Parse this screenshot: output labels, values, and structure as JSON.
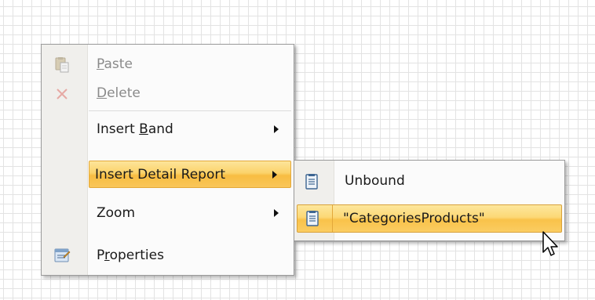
{
  "context_menu": {
    "items": [
      {
        "pre": "",
        "u": "P",
        "post": "aste",
        "icon": "paste-icon",
        "disabled": true
      },
      {
        "pre": "",
        "u": "D",
        "post": "elete",
        "icon": "delete-icon",
        "disabled": true
      },
      {
        "pre": "Insert ",
        "u": "B",
        "post": "and",
        "icon": "",
        "submenu": true
      },
      {
        "pre": "Insert Detail Report",
        "u": "",
        "post": "",
        "icon": "",
        "submenu": true,
        "highlighted": true
      },
      {
        "pre": "Zoom",
        "u": "",
        "post": "",
        "icon": "",
        "submenu": true
      },
      {
        "pre": "P",
        "u": "r",
        "post": "operties",
        "icon": "properties-icon"
      }
    ]
  },
  "submenu": {
    "items": [
      {
        "label": "Unbound",
        "icon": "report-icon"
      },
      {
        "label": "\"CategoriesProducts\"",
        "icon": "report-icon",
        "highlighted": true
      }
    ]
  },
  "colors": {
    "highlight": "#f9c65a",
    "grid_line": "#e3e3e3",
    "disabled_text": "#8a8a8a"
  }
}
